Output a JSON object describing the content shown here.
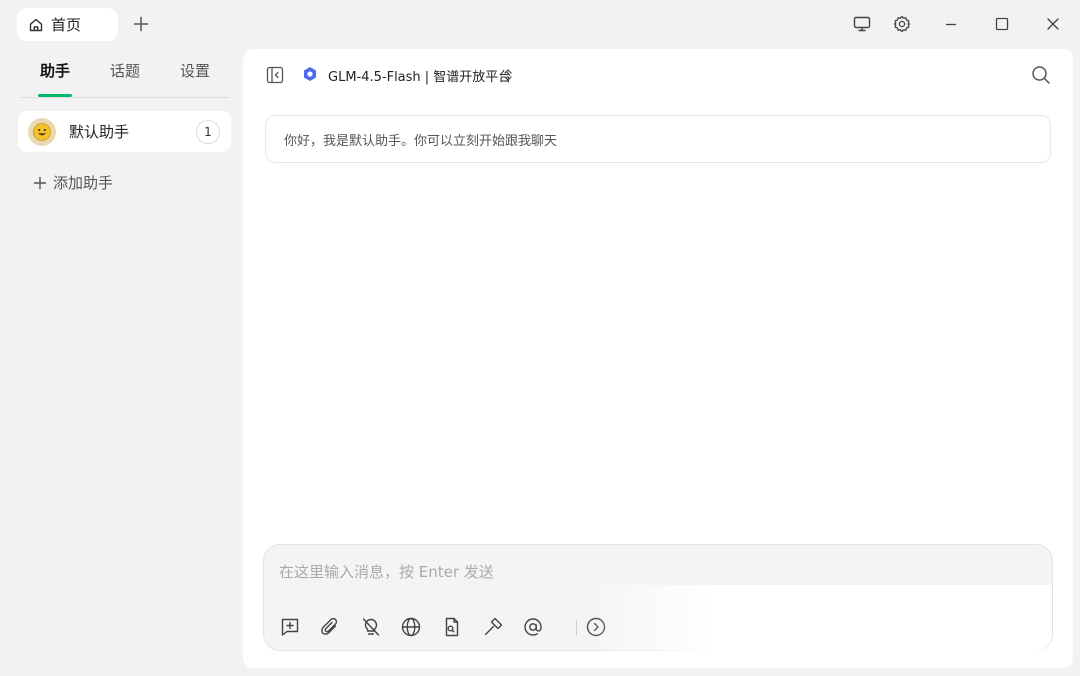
{
  "titlebar": {
    "home_tab_label": "首页",
    "icons": [
      "home-icon",
      "plus-icon",
      "monitor-icon",
      "gear-icon",
      "minimize-icon",
      "maximize-icon",
      "close-icon"
    ]
  },
  "sidebar": {
    "tabs": [
      {
        "label": "助手",
        "active": true
      },
      {
        "label": "话题",
        "active": false
      },
      {
        "label": "设置",
        "active": false
      }
    ],
    "assistant": {
      "name": "默认助手",
      "count": "1",
      "avatar": "smiley-emoji"
    },
    "add_label": "添加助手",
    "accent_color": "#00b96b"
  },
  "main": {
    "model_label": "GLM-4.5-Flash | 智谱开放平台",
    "model_logo_color": "#4f6af0",
    "greeting": "你好，我是默认助手。你可以立刻开始跟我聊天",
    "input": {
      "placeholder": "在这里输入消息，按 Enter 发送",
      "value": ""
    },
    "toolbar_icons": [
      "new-topic-icon",
      "attachment-icon",
      "lightbulb-off-icon",
      "globe-icon",
      "file-search-icon",
      "hammer-icon",
      "at-icon",
      "expand-icon"
    ]
  }
}
